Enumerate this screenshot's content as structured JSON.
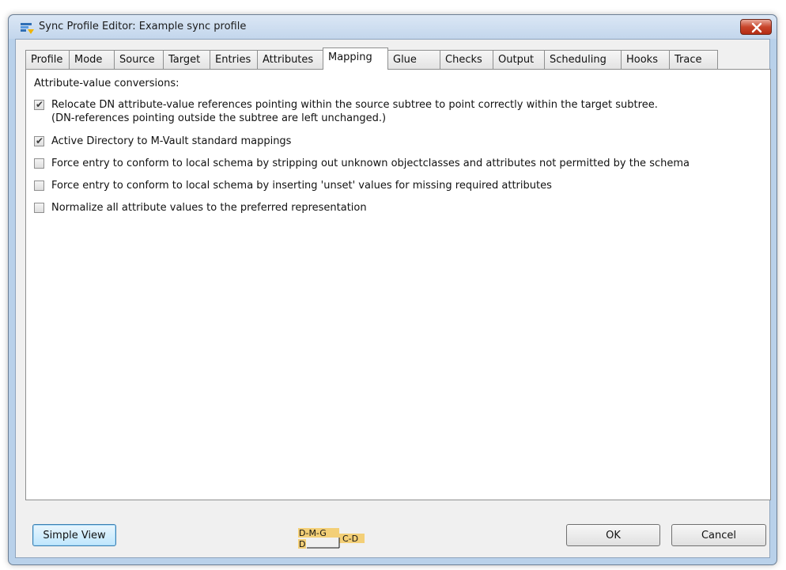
{
  "window": {
    "title": "Sync Profile Editor: Example sync profile",
    "app_icon": "sync-profile-icon",
    "close_icon": "close-icon"
  },
  "tabs": [
    {
      "label": "Profile",
      "active": false
    },
    {
      "label": "Mode",
      "active": false
    },
    {
      "label": "Source",
      "active": false
    },
    {
      "label": "Target",
      "active": false
    },
    {
      "label": "Entries",
      "active": false
    },
    {
      "label": "Attributes",
      "active": false
    },
    {
      "label": "Mapping",
      "active": true
    },
    {
      "label": "Glue",
      "active": false
    },
    {
      "label": "Checks",
      "active": false
    },
    {
      "label": "Output",
      "active": false
    },
    {
      "label": "Scheduling",
      "active": false
    },
    {
      "label": "Hooks",
      "active": false
    },
    {
      "label": "Trace",
      "active": false
    }
  ],
  "mapping": {
    "section_label": "Attribute-value conversions:",
    "options": [
      {
        "label": "Relocate DN attribute-value references pointing within the source subtree to point correctly within the target subtree.",
        "label_line2": "(DN-references pointing outside the subtree are left unchanged.)",
        "checked": true
      },
      {
        "label": "Active Directory to M-Vault standard mappings",
        "checked": true
      },
      {
        "label": "Force entry to conform to local schema by stripping out unknown objectclasses and attributes not permitted by the schema",
        "checked": false
      },
      {
        "label": "Force entry to conform to local schema by inserting 'unset' values for missing required attributes",
        "checked": false
      },
      {
        "label": "Normalize all attribute values to the preferred representation",
        "checked": false
      }
    ]
  },
  "footer": {
    "simple_view_label": "Simple View",
    "ok_label": "OK",
    "cancel_label": "Cancel",
    "logo": {
      "row1": "D-M-G",
      "row2": "D",
      "right": "C-D",
      "color": "#f3cf77"
    }
  },
  "colors": {
    "title_bar": "#c3d6ec",
    "close_button": "#c8452b",
    "dialog_bg": "#f0f0f0",
    "focus_border": "#3c7fb1"
  }
}
